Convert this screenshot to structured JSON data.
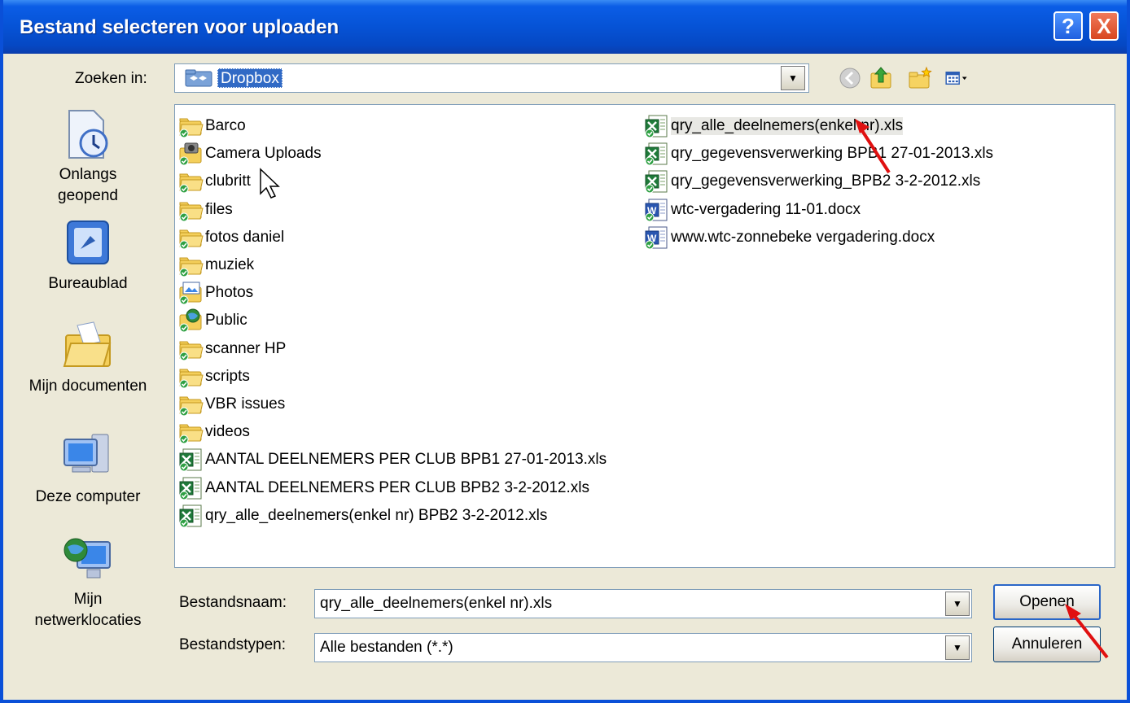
{
  "window": {
    "title": "Bestand selecteren voor uploaden",
    "help_label": "?",
    "close_label": "X"
  },
  "lookin": {
    "label": "Zoeken in:",
    "value": "Dropbox"
  },
  "places": [
    {
      "label_line1": "Onlangs",
      "label_line2": "geopend"
    },
    {
      "label_line1": "Bureaublad",
      "label_line2": ""
    },
    {
      "label_line1": "Mijn documenten",
      "label_line2": ""
    },
    {
      "label_line1": "Deze computer",
      "label_line2": ""
    },
    {
      "label_line1": "Mijn",
      "label_line2": "netwerklocaties"
    }
  ],
  "files_col1": [
    {
      "name": "Barco",
      "icon": "folder"
    },
    {
      "name": "Camera Uploads",
      "icon": "camera-folder"
    },
    {
      "name": "clubritt",
      "icon": "folder"
    },
    {
      "name": "files",
      "icon": "folder"
    },
    {
      "name": "fotos daniel",
      "icon": "folder"
    },
    {
      "name": "muziek",
      "icon": "folder"
    },
    {
      "name": "Photos",
      "icon": "photos-folder"
    },
    {
      "name": "Public",
      "icon": "public-folder"
    },
    {
      "name": "scanner HP",
      "icon": "folder"
    },
    {
      "name": "scripts",
      "icon": "folder"
    },
    {
      "name": "VBR issues",
      "icon": "folder"
    },
    {
      "name": "videos",
      "icon": "folder"
    },
    {
      "name": "AANTAL DEELNEMERS PER CLUB BPB1 27-01-2013.xls",
      "icon": "excel"
    },
    {
      "name": "AANTAL DEELNEMERS PER CLUB BPB2 3-2-2012.xls",
      "icon": "excel"
    },
    {
      "name": "qry_alle_deelnemers(enkel nr) BPB2 3-2-2012.xls",
      "icon": "excel"
    }
  ],
  "files_col2": [
    {
      "name": "qry_alle_deelnemers(enkel nr).xls",
      "icon": "excel",
      "selected": true
    },
    {
      "name": "qry_gegevensverwerking BPB1 27-01-2013.xls",
      "icon": "excel"
    },
    {
      "name": "qry_gegevensverwerking_BPB2 3-2-2012.xls",
      "icon": "excel"
    },
    {
      "name": "wtc-vergadering 11-01.docx",
      "icon": "word"
    },
    {
      "name": "www.wtc-zonnebeke vergadering.docx",
      "icon": "word"
    }
  ],
  "filename": {
    "label": "Bestandsnaam:",
    "value": "qry_alle_deelnemers(enkel nr).xls"
  },
  "filetype": {
    "label": "Bestandstypen:",
    "value": "Alle bestanden (*.*)"
  },
  "buttons": {
    "open": "Openen",
    "cancel": "Annuleren"
  },
  "colors": {
    "title_bar": "#0653d6",
    "selection": "#316ac5",
    "annotation_arrow": "#e01010"
  }
}
